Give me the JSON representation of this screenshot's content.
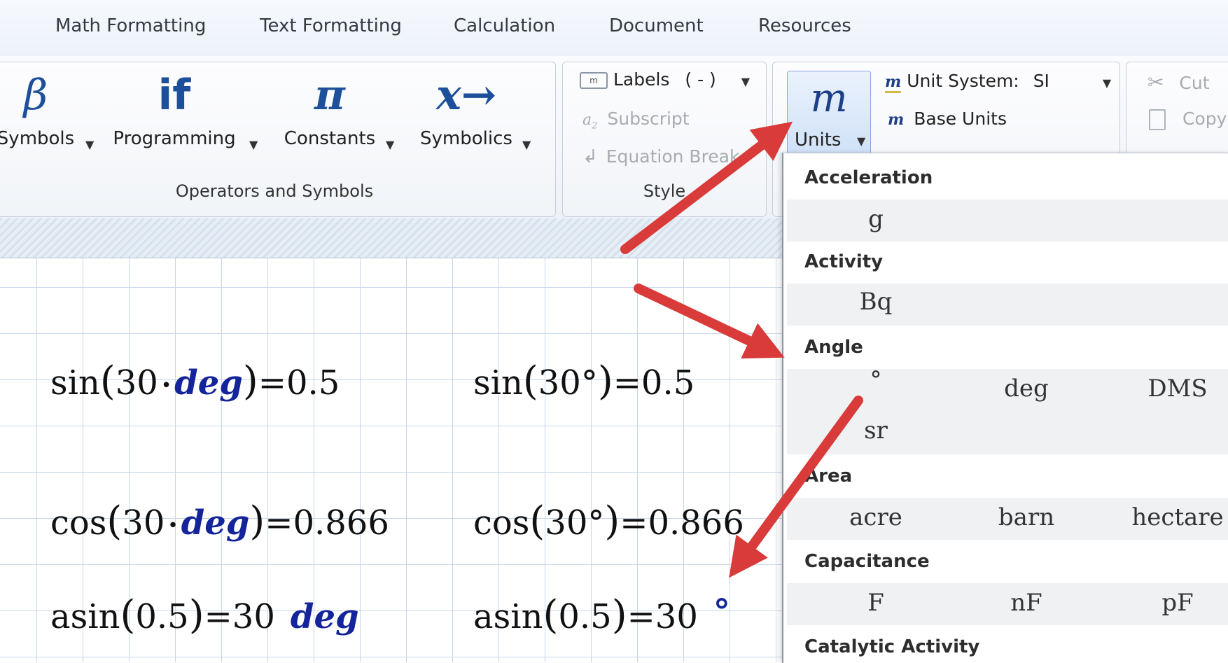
{
  "tabs": [
    "Math Formatting",
    "Text Formatting",
    "Calculation",
    "Document",
    "Resources"
  ],
  "operators_group": {
    "label": "Operators and Symbols",
    "buttons": [
      {
        "icon": "β",
        "label": "Symbols"
      },
      {
        "icon": "if",
        "label": "Programming"
      },
      {
        "icon": "π",
        "label": "Constants"
      },
      {
        "icon": "x→",
        "label": "Symbolics"
      }
    ]
  },
  "style_group": {
    "label": "Style",
    "labels_text": "Labels",
    "labels_value": "( - )",
    "subscript": "Subscript",
    "equation_break": "Equation Break"
  },
  "units_group": {
    "button_icon": "m",
    "button_label": "Units",
    "unit_system_label": "Unit System:",
    "unit_system_value": "SI",
    "base_units": "Base Units"
  },
  "clipboard_group": {
    "cut": "Cut",
    "copy": "Copy"
  },
  "equations": {
    "sin1": {
      "fn": "sin",
      "arg": "30",
      "dot": "•",
      "unit": "deg",
      "eq": "=",
      "result": "0.5"
    },
    "cos1": {
      "fn": "cos",
      "arg": "30",
      "dot": "•",
      "unit": "deg",
      "eq": "=",
      "result": "0.866"
    },
    "asin1": {
      "fn": "asin",
      "arg": "0.5",
      "eq": "=",
      "result": "30",
      "unit": "deg"
    },
    "sin2": {
      "fn": "sin",
      "arg": "30°",
      "eq": "=",
      "result": "0.5"
    },
    "cos2": {
      "fn": "cos",
      "arg": "30°",
      "eq": "=",
      "result": "0.866"
    },
    "asin2": {
      "fn": "asin",
      "arg": "0.5",
      "eq": "=",
      "result": "30",
      "unit": "°"
    }
  },
  "units_dropdown": {
    "acceleration": {
      "name": "Acceleration",
      "units": [
        "g"
      ]
    },
    "activity": {
      "name": "Activity",
      "units": [
        "Bq"
      ]
    },
    "angle": {
      "name": "Angle",
      "units": [
        "°",
        "deg",
        "DMS",
        "sr"
      ]
    },
    "area": {
      "name": "Area",
      "units": [
        "acre",
        "barn",
        "hectare"
      ]
    },
    "capacitance": {
      "name": "Capacitance",
      "units": [
        "F",
        "nF",
        "pF"
      ]
    },
    "catalytic": {
      "name": "Catalytic Activity"
    }
  },
  "colors": {
    "unit_blue": "#14249a",
    "annotation_arrow": "#d93a3a",
    "icon_blue": "#1d4f9a"
  }
}
